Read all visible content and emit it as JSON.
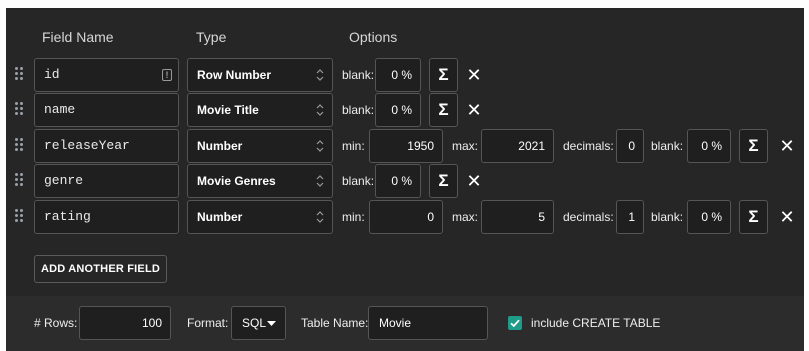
{
  "headers": {
    "field_name": "Field Name",
    "type": "Type",
    "options": "Options"
  },
  "fields": [
    {
      "name": "id",
      "type": "Row Number",
      "has_alert_icon": true,
      "options": [
        {
          "label": "blank:",
          "value": "0 %"
        }
      ]
    },
    {
      "name": "name",
      "type": "Movie Title",
      "options": [
        {
          "label": "blank:",
          "value": "0 %"
        }
      ]
    },
    {
      "name": "releaseYear",
      "type": "Number",
      "options": [
        {
          "label": "min:",
          "value": "1950"
        },
        {
          "label": "max:",
          "value": "2021"
        },
        {
          "label": "decimals:",
          "value": "0"
        },
        {
          "label": "blank:",
          "value": "0 %"
        }
      ]
    },
    {
      "name": "genre",
      "type": "Movie Genres",
      "options": [
        {
          "label": "blank:",
          "value": "0 %"
        }
      ]
    },
    {
      "name": "rating",
      "type": "Number",
      "options": [
        {
          "label": "min:",
          "value": "0"
        },
        {
          "label": "max:",
          "value": "5"
        },
        {
          "label": "decimals:",
          "value": "1"
        },
        {
          "label": "blank:",
          "value": "0 %"
        }
      ]
    }
  ],
  "buttons": {
    "formula": "Σ",
    "remove": "✕",
    "alert": "!",
    "add_field": "ADD ANOTHER FIELD"
  },
  "footer": {
    "rows_label": "# Rows:",
    "rows_value": "100",
    "format_label": "Format:",
    "format_value": "SQL",
    "table_name_label": "Table Name:",
    "table_name_value": "Movie",
    "create_table_label": "include CREATE TABLE",
    "create_table_checked": true
  },
  "colors": {
    "background": "#262626",
    "checkbox": "#1f9b8a"
  }
}
